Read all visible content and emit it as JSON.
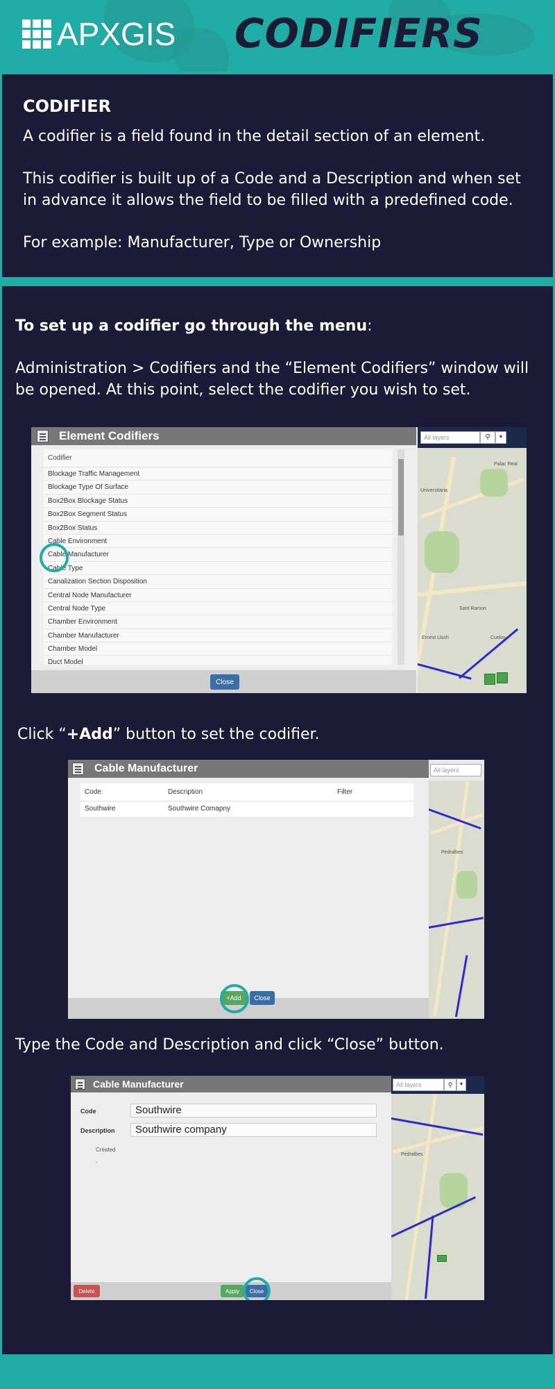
{
  "header": {
    "logo_text": "APXGIS",
    "page_title": "CODIFIERS"
  },
  "intro": {
    "heading": "CODIFIER",
    "paragraphs": [
      "A codifier is a field found in the detail section of an element.",
      "This codifier is built up of a Code and a Description and when set in advance it allows the field to be filled with a predefined code.",
      "For example: Manufacturer, Type or Ownership"
    ]
  },
  "steps": {
    "step1_bold": "To set up a codifier go through the menu",
    "step1_colon": ":",
    "step1_text": "Administration > Codifiers and the “Element Codifiers” window will be opened. At this point, select the codifier you wish to set.",
    "step2_pre": "Click “",
    "step2_bold": "+Add",
    "step2_post": "” button to set the codifier.",
    "step3_text": "Type the Code and Description and click “Close” button."
  },
  "shot1": {
    "title": "Element Codifiers",
    "list_header": "Codifier",
    "items": [
      "Blockage Traffic Management",
      "Blockage Type Of Surface",
      "Box2Box Blockage Status",
      "Box2Box Segment Status",
      "Box2Box Status",
      "Cable Environment",
      "Cable Manufacturer",
      "Cable Type",
      "Canalization Section Disposition",
      "Central Node Manufacturer",
      "Central Node Type",
      "Chamber Environment",
      "Chamber Manufacturer",
      "Chamber Model",
      "Duct Model"
    ],
    "close_label": "Close",
    "search_placeholder": "All layers",
    "search_icon": "search-icon",
    "map_labels": [
      "Universitaria",
      "Palac Real",
      "Ernest Lluch",
      "Sant Ramon",
      "Cuelos"
    ]
  },
  "shot2": {
    "title": "Cable Manufacturer",
    "columns": [
      "Code",
      "Description",
      "Filter"
    ],
    "rows": [
      [
        "Southwire",
        "Southwire Comapny",
        ""
      ]
    ],
    "add_label": "+Add",
    "close_label": "Close",
    "search_placeholder": "All layers",
    "map_labels": [
      "Pedralbes"
    ]
  },
  "shot3": {
    "title": "Cable Manufacturer",
    "code_label": "Code",
    "code_value": "Southwire",
    "description_label": "Description",
    "description_value": "Southwire company",
    "created_label": "Created",
    "created_value": "-",
    "delete_label": "Delete",
    "apply_label": "Apply",
    "close_label": "Close",
    "search_placeholder": "All layers",
    "map_labels": [
      "Pedralbes"
    ]
  },
  "colors": {
    "teal": "#1fada6",
    "navy": "#1b1b38",
    "green": "#57a75f",
    "blue": "#3b6ea6",
    "red": "#c9534f"
  }
}
